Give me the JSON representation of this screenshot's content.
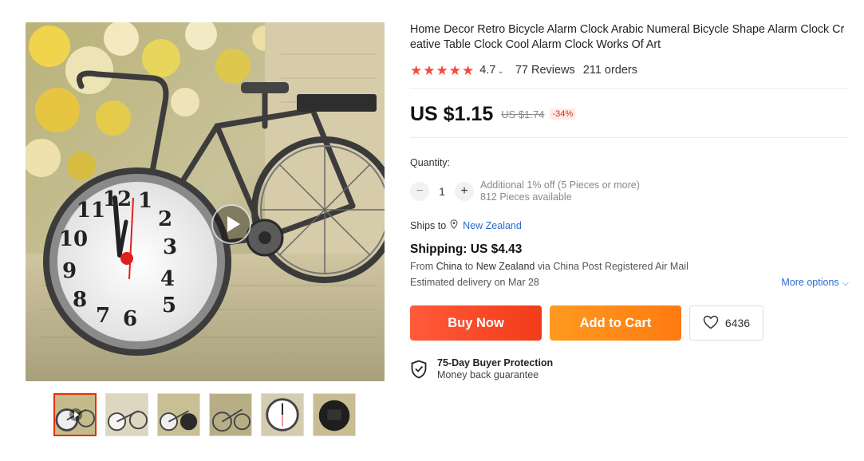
{
  "product": {
    "title": "Home Decor Retro Bicycle Alarm Clock Arabic Numeral Bicycle Shape Alarm Clock Creative Table Clock Cool Alarm Clock Works Of Art",
    "rating": "4.7",
    "stars_filled": 5,
    "reviews_label": "77 Reviews",
    "orders_label": "211 orders",
    "price": "US $1.15",
    "original_price": "US $1.74",
    "discount": "-34%"
  },
  "quantity": {
    "label": "Quantity:",
    "value": "1",
    "minus": "−",
    "plus": "+",
    "note_line1": "Additional 1% off (5 Pieces or more)",
    "note_line2": "812 Pieces available"
  },
  "shipping": {
    "ships_to_label": "Ships to",
    "country": "New Zealand",
    "title": "Shipping: US $4.43",
    "from_prefix": "From",
    "from_country": "China",
    "to_prefix": "to",
    "to_country": "New Zealand",
    "via_text": "via China Post Registered Air Mail",
    "delivery": "Estimated delivery on Mar 28",
    "more_options": "More options"
  },
  "actions": {
    "buy_now": "Buy Now",
    "add_to_cart": "Add to Cart",
    "wishlist_count": "6436"
  },
  "protection": {
    "title": "75-Day Buyer Protection",
    "subtitle": "Money back guarantee"
  },
  "gallery": {
    "thumbnails": [
      "video",
      "image",
      "image",
      "image",
      "image",
      "image"
    ],
    "active_thumbnail": 0
  },
  "colors": {
    "accent_red": "#e62e04",
    "buy_now": "#f23c18",
    "add_to_cart": "#ff8a15",
    "star": "#f6483f",
    "link_blue": "#2a6ad5"
  },
  "icons": [
    "play-icon",
    "star-icon",
    "chevron-down-icon",
    "location-pin-icon",
    "heart-icon",
    "shield-check-icon"
  ]
}
